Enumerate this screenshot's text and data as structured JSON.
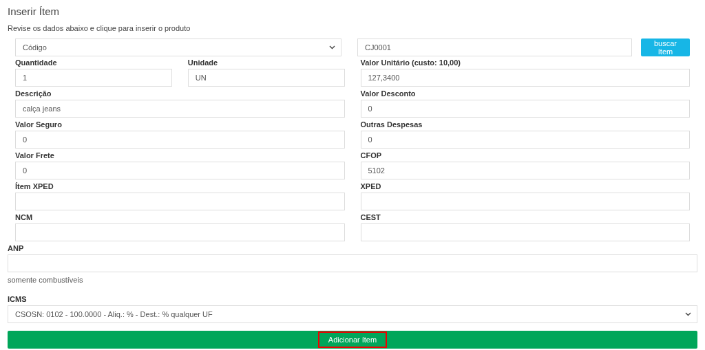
{
  "title": "Inserir Ítem",
  "subtitle": "Revise os dados abaixo e clique para inserir o produto",
  "search": {
    "type": "Código",
    "code": "CJ0001",
    "button": "buscar ítem"
  },
  "fields": [
    {
      "label": "Quantidade",
      "value": "1",
      "kind": "quarter"
    },
    {
      "label": "Unidade",
      "value": "UN",
      "kind": "quarter"
    },
    {
      "label": "Valor Unitário (custo: 10,00)",
      "value": "127,3400",
      "kind": "half"
    },
    {
      "label": "Descrição",
      "value": "calça jeans",
      "kind": "half"
    },
    {
      "label": "Valor Desconto",
      "value": "0",
      "kind": "half"
    },
    {
      "label": "Valor Seguro",
      "value": "0",
      "kind": "half"
    },
    {
      "label": "Outras Despesas",
      "value": "0",
      "kind": "half"
    },
    {
      "label": "Valor Frete",
      "value": "0",
      "kind": "half"
    },
    {
      "label": "CFOP",
      "value": "5102",
      "kind": "half"
    },
    {
      "label": "Ítem XPED",
      "kind": "half"
    },
    {
      "label": "XPED",
      "kind": "half"
    },
    {
      "label": "NCM",
      "kind": "half"
    },
    {
      "label": "CEST",
      "kind": "half"
    }
  ],
  "anp": {
    "label": "ANP",
    "help": "somente combustíveis"
  },
  "icms": {
    "label": "ICMS",
    "value": "CSOSN: 0102 - 100.0000 - Aliq.: % - Dest.: % qualquer UF"
  },
  "submit": {
    "label": "Adicionar ítem",
    "highlighted": true
  }
}
